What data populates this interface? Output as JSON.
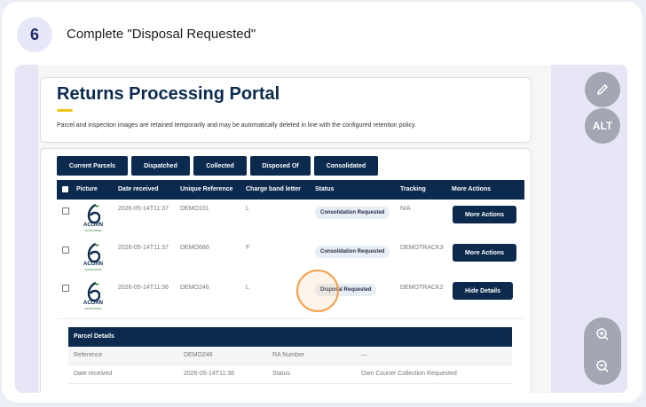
{
  "step": {
    "number": "6",
    "title": "Complete \"Disposal Requested\""
  },
  "portal": {
    "title": "Returns Processing Portal",
    "policy": "Parcel and inspection images are retained temporarily and may be automatically deleted in line with the configured retention policy."
  },
  "tabs": [
    "Current Parcels",
    "Dispatched",
    "Collected",
    "Disposed Of",
    "Consolidated"
  ],
  "table": {
    "headers": {
      "picture": "Picture",
      "date": "Date received",
      "ref": "Unique Reference",
      "band": "Charge band letter",
      "status": "Status",
      "tracking": "Tracking",
      "actions": "More Actions"
    },
    "logo_text": "ACORN",
    "logo_sub": "WORLDWIDE",
    "rows": [
      {
        "date": "2026-05-14T11:37",
        "ref": "DEMO101",
        "band": "L",
        "status": "Consolidation Requested",
        "tracking": "N/A",
        "action": "More Actions"
      },
      {
        "date": "2026-05-14T11:37",
        "ref": "DEMO680",
        "band": "F",
        "status": "Consolidation Requested",
        "tracking": "DEMOTRACK3",
        "action": "More Actions"
      },
      {
        "date": "2026-05-14T11:36",
        "ref": "DEMO246",
        "band": "L",
        "status": "Disposal Requested",
        "tracking": "DEMOTRACK2",
        "action": "Hide Details"
      }
    ]
  },
  "details": {
    "heading": "Parcel Details",
    "rows": [
      {
        "label1": "Reference",
        "value1": "DEMO246",
        "label2": "RA Number",
        "value2": "—"
      },
      {
        "label1": "Date received",
        "value1": "2026-05-14T11:36",
        "label2": "Status",
        "value2": "Own Courier Collection Requested"
      }
    ]
  },
  "side": {
    "alt_label": "ALT"
  },
  "colors": {
    "navy": "#0b2a4e",
    "accent_yellow": "#f0c419",
    "highlight": "#f5a04a"
  }
}
